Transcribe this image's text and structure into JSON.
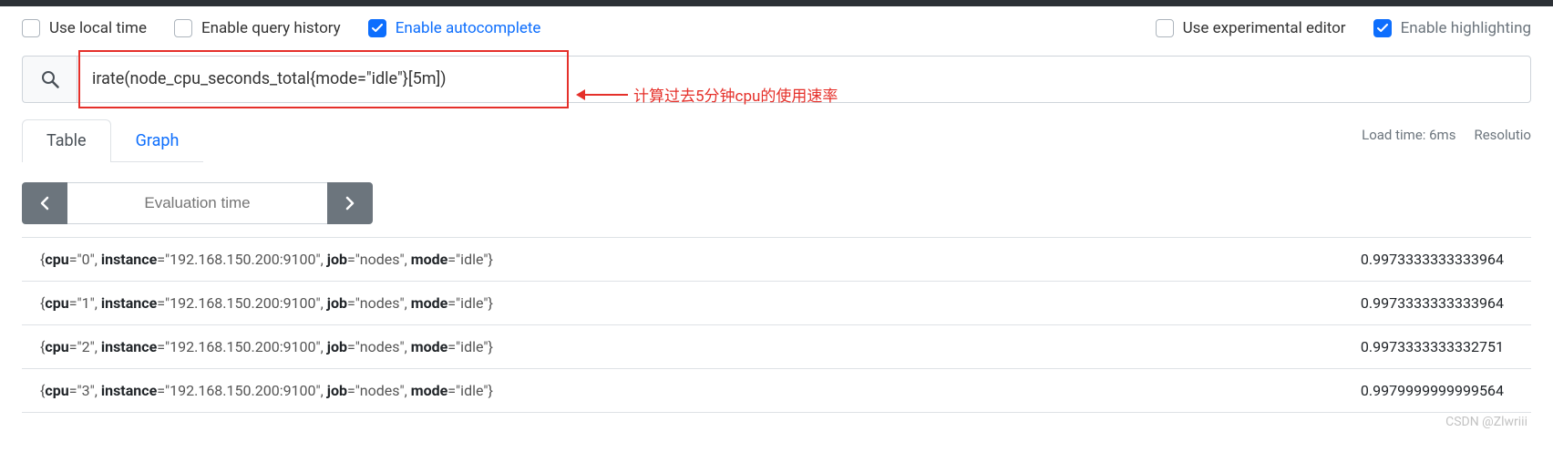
{
  "options": {
    "local_time": {
      "label": "Use local time",
      "checked": false
    },
    "query_history": {
      "label": "Enable query history",
      "checked": false
    },
    "autocomplete": {
      "label": "Enable autocomplete",
      "checked": true
    },
    "experimental": {
      "label": "Use experimental editor",
      "checked": false
    },
    "highlighting": {
      "label": "Enable highlighting",
      "checked": true
    }
  },
  "query": {
    "value": "irate(node_cpu_seconds_total{mode=\"idle\"}[5m])"
  },
  "annotation": {
    "text": "计算过去5分钟cpu的使用速率"
  },
  "tabs": {
    "table": "Table",
    "graph": "Graph"
  },
  "stats": {
    "load_time": "Load time: 6ms",
    "resolution": "Resolutio"
  },
  "eval": {
    "placeholder": "Evaluation time"
  },
  "results": [
    {
      "cpu": "0",
      "instance": "192.168.150.200:9100",
      "job": "nodes",
      "mode": "idle",
      "value": "0.9973333333333964"
    },
    {
      "cpu": "1",
      "instance": "192.168.150.200:9100",
      "job": "nodes",
      "mode": "idle",
      "value": "0.9973333333333964"
    },
    {
      "cpu": "2",
      "instance": "192.168.150.200:9100",
      "job": "nodes",
      "mode": "idle",
      "value": "0.9973333333332751"
    },
    {
      "cpu": "3",
      "instance": "192.168.150.200:9100",
      "job": "nodes",
      "mode": "idle",
      "value": "0.9979999999999564"
    }
  ],
  "watermark": "CSDN @Zlwriii"
}
